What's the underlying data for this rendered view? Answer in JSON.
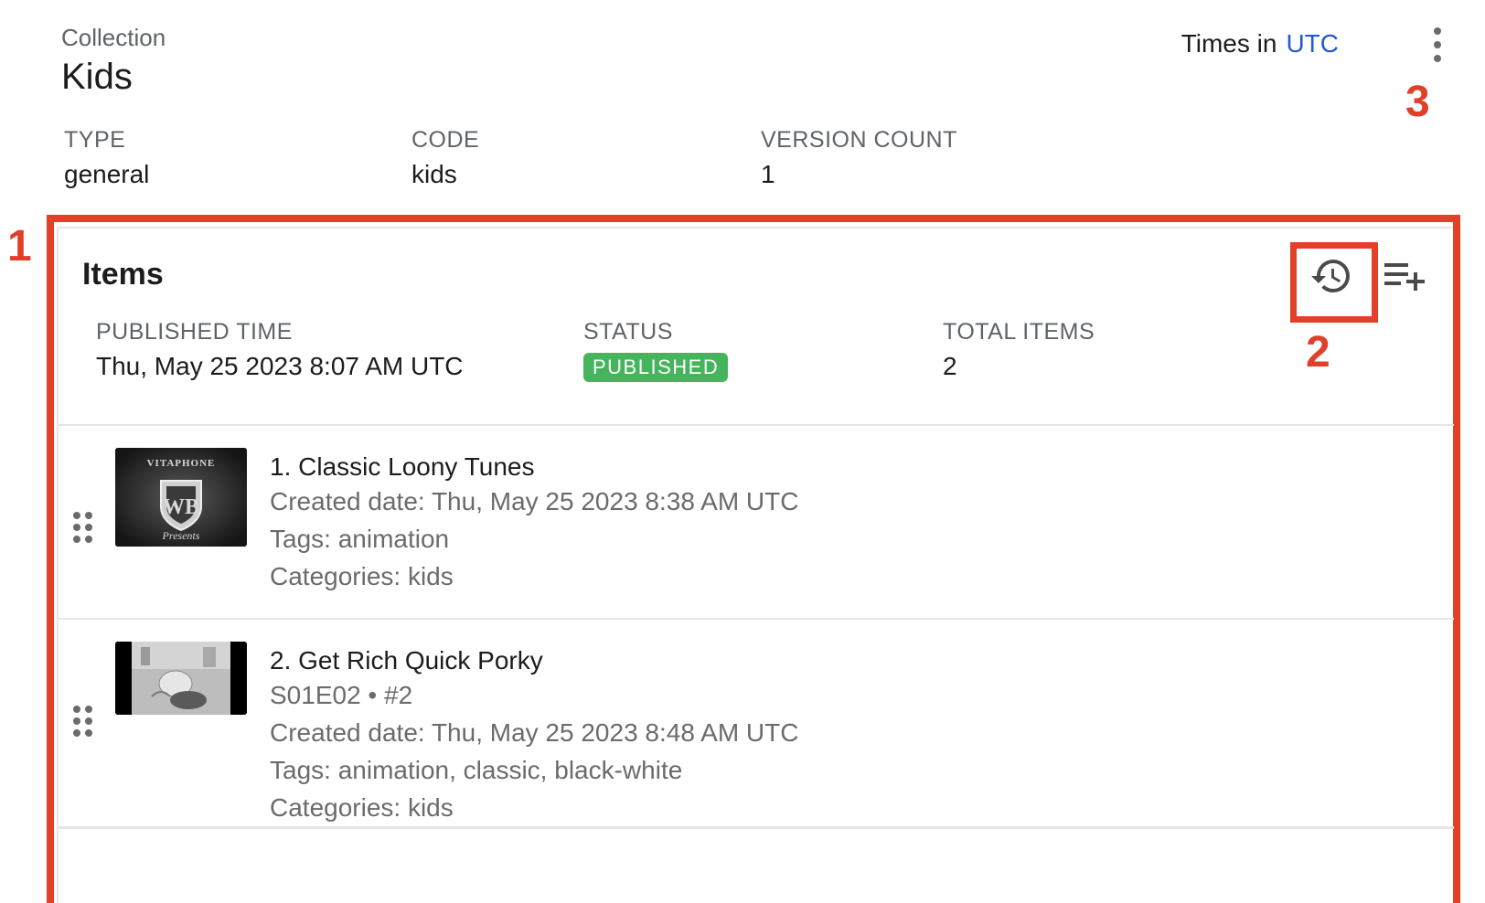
{
  "collection": {
    "label": "Collection",
    "name": "Kids"
  },
  "timezone": {
    "prefix": "Times in",
    "zone": "UTC"
  },
  "meta": {
    "type_label": "TYPE",
    "type_value": "general",
    "code_label": "CODE",
    "code_value": "kids",
    "version_label": "VERSION COUNT",
    "version_value": "1"
  },
  "annotations": {
    "one": "1",
    "two": "2",
    "three": "3"
  },
  "items_panel": {
    "title": "Items",
    "published_time_label": "PUBLISHED TIME",
    "published_time_value": "Thu, May 25 2023 8:07 AM UTC",
    "status_label": "STATUS",
    "status_value": "PUBLISHED",
    "total_label": "TOTAL ITEMS",
    "total_value": "2",
    "icons": {
      "history": "history-icon",
      "add_list": "playlist-add-icon",
      "more": "more-vertical-icon",
      "drag": "drag-handle-icon"
    },
    "colors": {
      "status_badge": "#46b35d",
      "link": "#1f5ad6",
      "annotation": "#e3402a"
    },
    "items": [
      {
        "title": "1. Classic Loony Tunes",
        "created": "Created date: Thu, May 25 2023 8:38 AM UTC",
        "tags": "Tags: animation",
        "categories": "Categories: kids",
        "thumb_text_top": "VITAPHONE",
        "thumb_text_mid": "WB",
        "thumb_text_bottom": "Presents"
      },
      {
        "title": "2. Get Rich Quick Porky",
        "episode": "S01E02 • #2",
        "created": "Created date: Thu, May 25 2023 8:48 AM UTC",
        "tags": "Tags: animation, classic, black-white",
        "categories": "Categories: kids"
      }
    ]
  }
}
